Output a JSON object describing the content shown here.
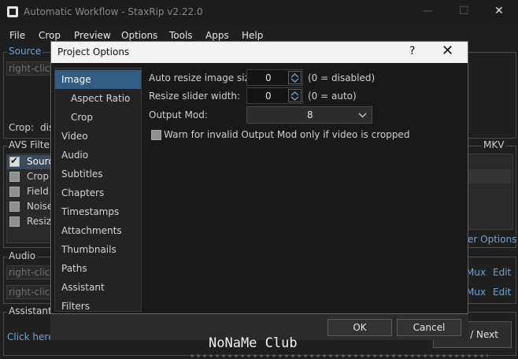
{
  "window": {
    "title": "Automatic Workflow - StaxRip v2.22.0",
    "controls": {
      "minimize": "—",
      "maximize": "☐",
      "close": "✕"
    }
  },
  "menu": [
    "File",
    "Crop",
    "Preview",
    "Options",
    "Tools",
    "Apps",
    "Help"
  ],
  "main": {
    "source": {
      "label": "Source",
      "placeholder": "right-click",
      "crop_label": "Crop:",
      "crop_value": "dis"
    },
    "avs_filters": {
      "label": "AVS Filters",
      "items": [
        {
          "label": "Source",
          "checked": true
        },
        {
          "label": "Crop",
          "checked": false
        },
        {
          "label": "Field",
          "checked": false
        },
        {
          "label": "Noise",
          "checked": false
        },
        {
          "label": "Resize",
          "checked": false
        }
      ]
    },
    "mkv": {
      "label": "MKV",
      "options_link": "er Options"
    },
    "audio": {
      "label": "Audio",
      "rows": [
        {
          "placeholder": "right-click",
          "mux": "Mux",
          "edit": "Edit"
        },
        {
          "placeholder": "right-click",
          "mux": "Mux",
          "edit": "Edit"
        }
      ]
    },
    "assistant": {
      "label": "Assistant",
      "link": "Click here",
      "next_button": "t / Next"
    }
  },
  "dialog": {
    "title": "Project Options",
    "help": "?",
    "close": "✕",
    "nav": [
      {
        "label": "Image",
        "indent": 0,
        "selected": true
      },
      {
        "label": "Aspect Ratio",
        "indent": 1,
        "selected": false
      },
      {
        "label": "Crop",
        "indent": 1,
        "selected": false
      },
      {
        "label": "Video",
        "indent": 0,
        "selected": false
      },
      {
        "label": "Audio",
        "indent": 0,
        "selected": false
      },
      {
        "label": "Subtitles",
        "indent": 0,
        "selected": false
      },
      {
        "label": "Chapters",
        "indent": 0,
        "selected": false
      },
      {
        "label": "Timestamps",
        "indent": 0,
        "selected": false
      },
      {
        "label": "Attachments",
        "indent": 0,
        "selected": false
      },
      {
        "label": "Thumbnails",
        "indent": 0,
        "selected": false
      },
      {
        "label": "Paths",
        "indent": 0,
        "selected": false
      },
      {
        "label": "Assistant",
        "indent": 0,
        "selected": false
      },
      {
        "label": "Filters",
        "indent": 0,
        "selected": false
      }
    ],
    "options": {
      "auto_resize": {
        "label": "Auto resize image size:",
        "value": "0",
        "hint": "(0 = disabled)"
      },
      "resize_slider": {
        "label": "Resize slider width:",
        "value": "0",
        "hint": "(0 = auto)"
      },
      "output_mod": {
        "label": "Output Mod:",
        "value": "8"
      },
      "warn_checkbox": {
        "label": "Warn for invalid Output Mod only if video is cropped",
        "checked": false
      }
    },
    "ok_button": "OK",
    "cancel_button": "Cancel"
  },
  "watermark": "NoNaMe Club"
}
